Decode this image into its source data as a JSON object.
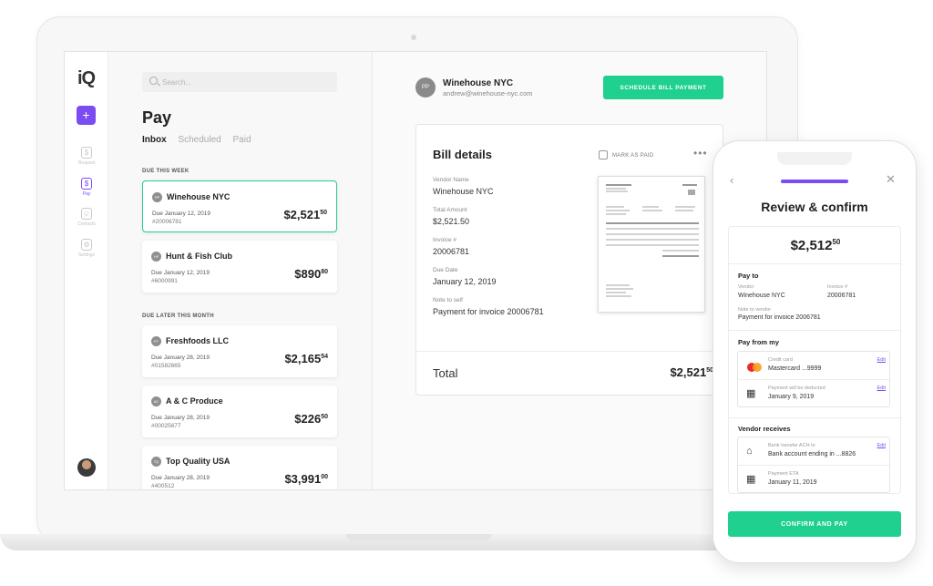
{
  "app": {
    "logo": "iQ",
    "add_label": "+"
  },
  "nav": {
    "items": [
      {
        "label": "Request",
        "icon": "request-icon",
        "glyph": "$"
      },
      {
        "label": "Pay",
        "icon": "pay-icon",
        "glyph": "$"
      },
      {
        "label": "Contacts",
        "icon": "contacts-icon",
        "glyph": "☺"
      },
      {
        "label": "Settings",
        "icon": "settings-icon",
        "glyph": "⚙"
      }
    ]
  },
  "list": {
    "search_placeholder": "Search...",
    "title": "Pay",
    "tabs": [
      "Inbox",
      "Scheduled",
      "Paid"
    ],
    "section_this_week": "DUE THIS WEEK",
    "section_later": "DUE LATER THIS MONTH",
    "bills": [
      {
        "initials": "PP",
        "vendor": "Winehouse NYC",
        "due": "Due January 12, 2019",
        "invoice": "#20006781",
        "amount": "$2,521",
        "cents": "50"
      },
      {
        "initials": "HF",
        "vendor": "Hunt & Fish Club",
        "due": "Due January 12, 2019",
        "invoice": "#6000991",
        "amount": "$890",
        "cents": "80"
      },
      {
        "initials": "FF",
        "vendor": "Freshfoods LLC",
        "due": "Due January 28, 2019",
        "invoice": "#01582665",
        "amount": "$2,165",
        "cents": "54"
      },
      {
        "initials": "AC",
        "vendor": "A & C Produce",
        "due": "Due January 28, 2019",
        "invoice": "#00025677",
        "amount": "$226",
        "cents": "50"
      },
      {
        "initials": "TQ",
        "vendor": "Top Quality USA",
        "due": "Due January 28, 2019",
        "invoice": "#400512",
        "amount": "$3,991",
        "cents": "00"
      }
    ]
  },
  "detail": {
    "vendor_initials": "PP",
    "vendor_name": "Winehouse NYC",
    "vendor_email": "andrew@winehouse-nyc.com",
    "schedule_button": "SCHEDULE BILL PAYMENT",
    "bill_title": "Bill details",
    "mark_paid": "MARK AS PAID",
    "more": "•••",
    "fields": [
      {
        "key": "Vendor Name",
        "value": "Winehouse NYC"
      },
      {
        "key": "Total Amount",
        "value": "$2,521.50"
      },
      {
        "key": "Invoice #",
        "value": "20006781"
      },
      {
        "key": "Due Date",
        "value": "January 12, 2019"
      },
      {
        "key": "Note to self",
        "value": "Payment for invoice 20006781"
      }
    ],
    "total_label": "Total",
    "total_amount": "$2,521",
    "total_cents": "50"
  },
  "mobile": {
    "back": "‹",
    "close": "✕",
    "progress": 1.0,
    "title": "Review & confirm",
    "amount": "$2,512",
    "cents": "50",
    "pay_to_heading": "Pay to",
    "vendor_key": "Vendor",
    "vendor_value": "Winehouse NYC",
    "invoice_key": "Invoice #",
    "invoice_value": "20006781",
    "note_key": "Note to vendor",
    "note_value": "Payment for invoice 2006781",
    "pay_from_heading": "Pay from my",
    "card_key": "Credit card",
    "card_value": "Mastercard ...9999",
    "deduct_key": "Payment will be deducted",
    "deduct_value": "January 9, 2019",
    "vendor_receives_heading": "Vendor receives",
    "bank_key": "Bank transfer ACH to",
    "bank_value": "Bank account ending in ...8826",
    "eta_key": "Payment ETA",
    "eta_value": "January 11, 2019",
    "edit_label": "Edit",
    "confirm_button": "CONFIRM AND PAY"
  },
  "colors": {
    "accent_purple": "#7b4cf2",
    "accent_green": "#1fd08f"
  }
}
